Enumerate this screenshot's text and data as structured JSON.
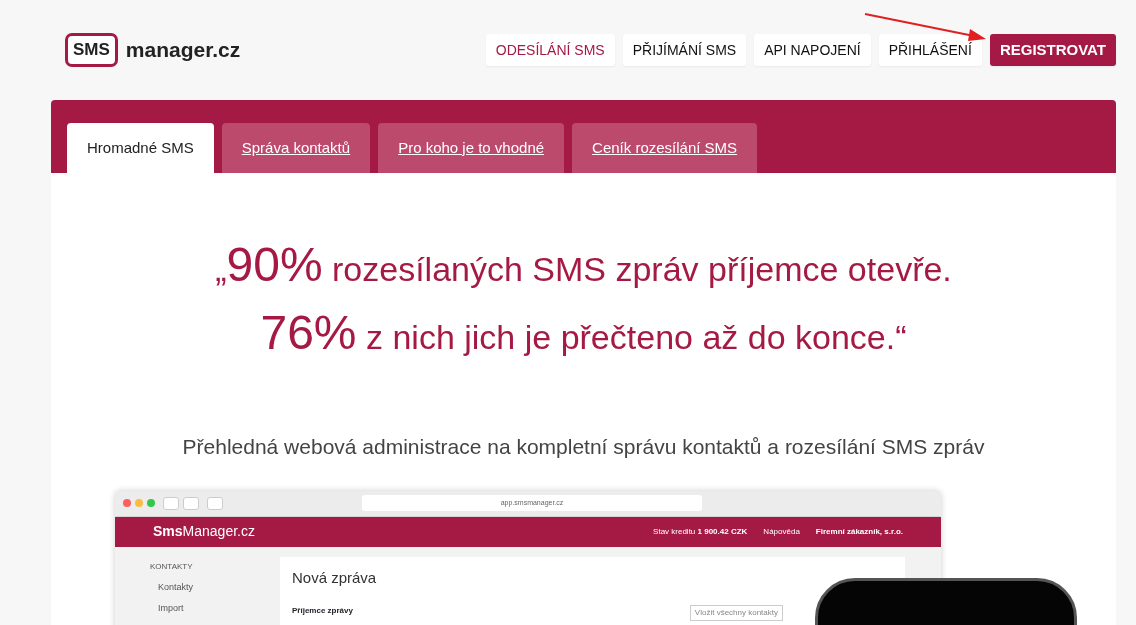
{
  "logo": {
    "badge": "SMS",
    "text": "manager.cz"
  },
  "nav": [
    {
      "label": "ODESÍLÁNÍ SMS",
      "kind": "link",
      "selected": true
    },
    {
      "label": "PŘIJÍMÁNÍ SMS",
      "kind": "link",
      "selected": false
    },
    {
      "label": "API NAPOJENÍ",
      "kind": "link",
      "selected": false
    },
    {
      "label": "PŘIHLÁŠENÍ",
      "kind": "link",
      "selected": false
    },
    {
      "label": "REGISTROVAT",
      "kind": "cta",
      "selected": false
    }
  ],
  "tabs": [
    {
      "label": "Hromadné SMS",
      "selected": true
    },
    {
      "label": "Správa kontaktů",
      "selected": false
    },
    {
      "label": "Pro koho je to vhodné",
      "selected": false
    },
    {
      "label": "Ceník rozesílání SMS",
      "selected": false
    }
  ],
  "quote": {
    "lines": [
      {
        "lead": "„",
        "number": "90%",
        "rest": "rozesílaných SMS zpráv příjemce otevře."
      },
      {
        "number": "76%",
        "rest": "z nich jich je přečteno až do konce.“"
      }
    ]
  },
  "subtitle": "Přehledná webová administrace na kompletní správu kontaktů a rozesílání SMS zpráv",
  "app_preview": {
    "address": "app.smsmanager.cz",
    "brand": "**Sms**Manager.cz",
    "credit": "Stav kreditu **1 900.42 CZK**",
    "help": "Nápověda",
    "account": "Firemní zákazník, s.r.o.",
    "sidebar_heading": "KONTAKTY",
    "sidebar_items": [
      "Kontakty",
      "Import"
    ],
    "card_title": "Nová zpráva",
    "recipients_label": "Příjemce zprávy",
    "insert_all": "Vložit všechny kontakty"
  }
}
